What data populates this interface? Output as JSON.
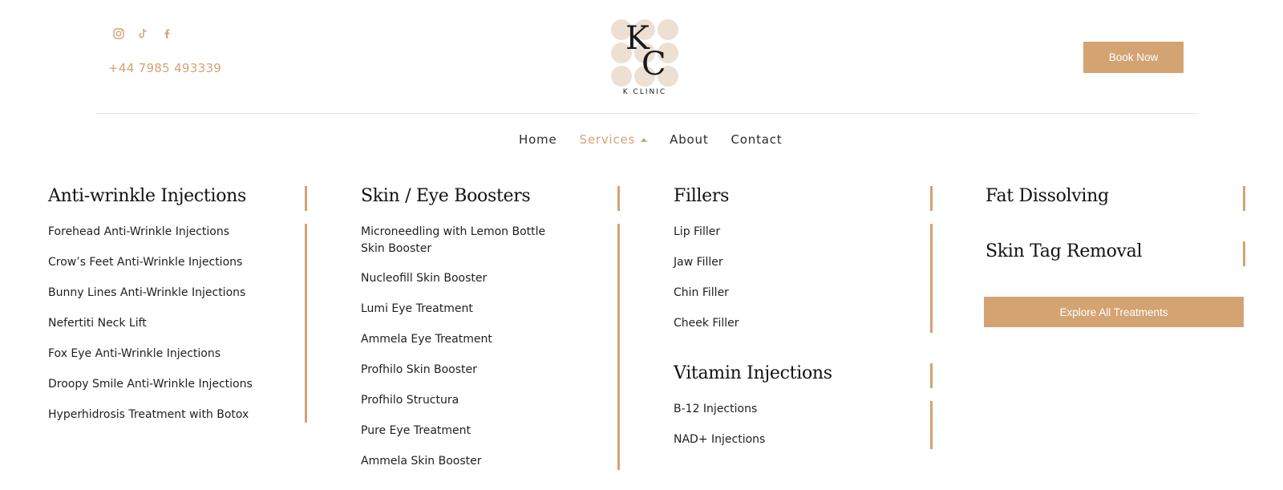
{
  "header": {
    "social": [
      {
        "icon": "instagram-icon"
      },
      {
        "icon": "tiktok-icon"
      },
      {
        "icon": "facebook-icon"
      }
    ],
    "phone": "+44 7985 493339",
    "logo": {
      "mark_k": "K",
      "mark_c": "C",
      "name": "K CLINIC"
    },
    "book_label": "Book Now"
  },
  "nav": {
    "home": "Home",
    "services": "Services",
    "about": "About",
    "contact": "Contact"
  },
  "menu": {
    "anti_wrinkle": {
      "title": "Anti-wrinkle Injections",
      "items": [
        "Forehead Anti-Wrinkle Injections",
        "Crow’s Feet Anti-Wrinkle Injections",
        "Bunny Lines Anti-Wrinkle Injections",
        "Nefertiti Neck Lift",
        "Fox Eye Anti-Wrinkle Injections",
        "Droopy Smile Anti-Wrinkle Injections",
        "Hyperhidrosis Treatment with Botox"
      ]
    },
    "boosters": {
      "title": "Skin / Eye Boosters",
      "items": [
        "Microneedling with Lemon Bottle Skin Booster",
        "Nucleofill Skin Booster",
        "Lumi Eye Treatment",
        "Ammela Eye Treatment",
        "Profhilo Skin Booster",
        "Profhilo Structura",
        "Pure Eye Treatment",
        "Ammela Skin Booster"
      ]
    },
    "fillers": {
      "title": "Fillers",
      "items": [
        "Lip Filler",
        "Jaw Filler",
        "Chin Filler",
        "Cheek Filler"
      ]
    },
    "vitamins": {
      "title": "Vitamin Injections",
      "items": [
        "B-12 Injections",
        "NAD+ Injections"
      ]
    },
    "fat_dissolving": {
      "title": "Fat Dissolving"
    },
    "skin_tag": {
      "title": "Skin Tag Removal"
    },
    "explore_label": "Explore All Treatments"
  },
  "colors": {
    "accent": "#d3a372",
    "logo_circles": "#ede0d3",
    "text": "#1a1a1a"
  }
}
